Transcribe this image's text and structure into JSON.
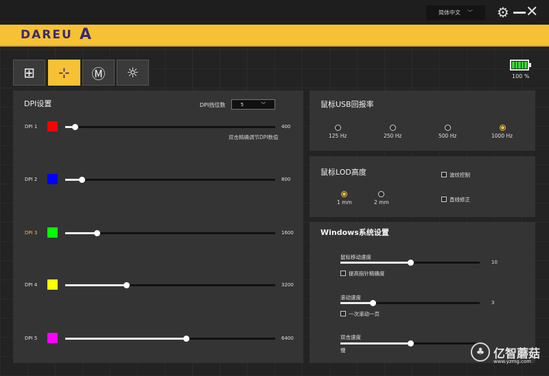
{
  "topbar": {
    "language": "简体中文",
    "language_chevron": "﹀",
    "settings_icon": "gear-icon",
    "minimize_icon": "minimize-icon",
    "close_icon": "close-icon"
  },
  "brand": {
    "logo_text": "DAREU",
    "logo_mark": "A",
    "accent": "#f6c234",
    "logo_color": "#3a2a70"
  },
  "modes": [
    {
      "icon": "plus-box-icon",
      "glyph": "⊞",
      "active": false
    },
    {
      "icon": "dpi-move-icon",
      "glyph": "⊹",
      "active": true
    },
    {
      "icon": "macro-m-icon",
      "glyph": "Ⓜ",
      "active": false
    },
    {
      "icon": "brightness-icon",
      "glyph": "☼",
      "active": false
    }
  ],
  "battery": {
    "level": "100 %",
    "color": "#39d639"
  },
  "dpi": {
    "title": "DPI设置",
    "count_label": "DPI挡位数",
    "count_value": "5",
    "hint": "双击精确调节DPI数值",
    "max": 16000,
    "rows": [
      {
        "label": "DPI 1",
        "color": "#ff0000",
        "value": 400,
        "value_text": "400",
        "fraction": 0.045,
        "active": false
      },
      {
        "label": "DPI 2",
        "color": "#0000ff",
        "value": 800,
        "value_text": "800",
        "fraction": 0.08,
        "active": false
      },
      {
        "label": "DPI 3",
        "color": "#00ff00",
        "value": 1600,
        "value_text": "1600",
        "fraction": 0.15,
        "active": true
      },
      {
        "label": "DPI 4",
        "color": "#ffff00",
        "value": 3200,
        "value_text": "3200",
        "fraction": 0.29,
        "active": false
      },
      {
        "label": "DPI 5",
        "color": "#ff00ff",
        "value": 6400,
        "value_text": "6400",
        "fraction": 0.575,
        "active": false
      }
    ]
  },
  "usb": {
    "title": "鼠标USB回报率",
    "options": [
      {
        "label": "125 Hz",
        "selected": false
      },
      {
        "label": "250 Hz",
        "selected": false
      },
      {
        "label": "500 Hz",
        "selected": false
      },
      {
        "label": "1000 Hz",
        "selected": true
      }
    ]
  },
  "lod": {
    "title": "鼠标LOD高度",
    "options": [
      {
        "label": "1 mm",
        "selected": true
      },
      {
        "label": "2 mm",
        "selected": false
      }
    ],
    "checks": [
      {
        "label": "波纹控制",
        "checked": false
      },
      {
        "label": "直线修正",
        "checked": false
      }
    ]
  },
  "windows": {
    "title": "Windows系统设置",
    "pointer_speed_label": "鼠标移动速度",
    "pointer_speed_value": "10",
    "pointer_speed_fraction": 0.5,
    "precision_label": "提高指针精确度",
    "scroll_label": "滚动速度",
    "scroll_value": "3",
    "scroll_fraction": 0.23,
    "scroll_page_label": "一次滚动一页",
    "double_click_label": "双击速度",
    "double_click_fraction": 0.5,
    "double_click_slow": "慢"
  },
  "watermark": {
    "text": "亿智蘑菇",
    "url": "www.yzmg.com"
  }
}
